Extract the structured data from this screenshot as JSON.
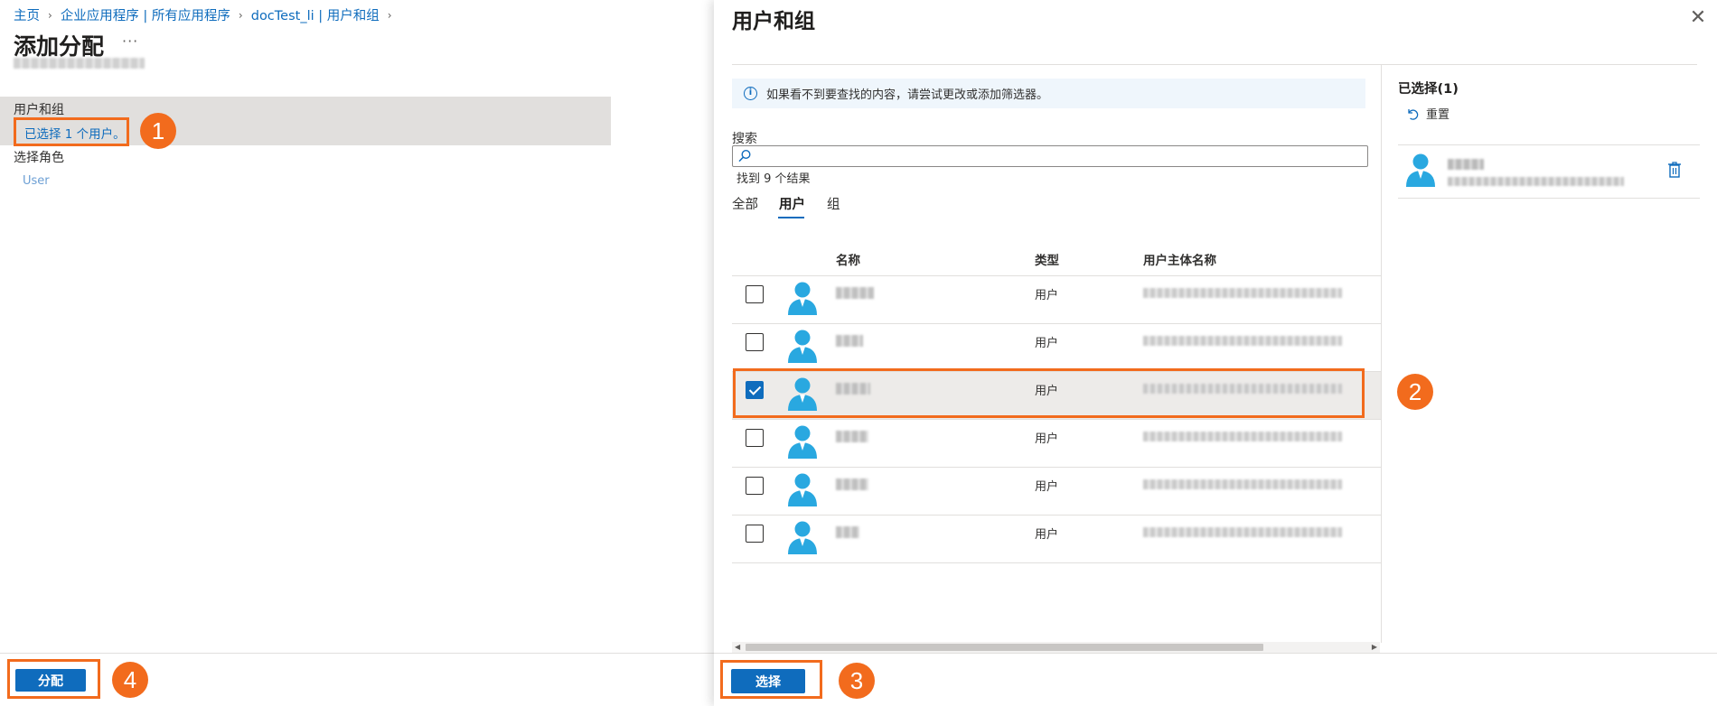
{
  "left": {
    "breadcrumb": [
      "主页",
      "企业应用程序 | 所有应用程序",
      "docTest_li | 用户和组"
    ],
    "breadcrumb_sep": "›",
    "title": "添加分配",
    "more": "···",
    "users_groups_label": "用户和组",
    "selected_users": "已选择 1 个用户。",
    "role_label": "选择角色",
    "role_value": "User",
    "assign_button": "分配"
  },
  "annotations": [
    "1",
    "2",
    "3",
    "4"
  ],
  "blade": {
    "title": "用户和组",
    "close": "✕",
    "info_text": "如果看不到要查找的内容，请尝试更改或添加筛选器。",
    "info_icon": "i",
    "search_label": "搜索",
    "search_placeholder": "",
    "result_count": "找到 9 个结果",
    "tabs": [
      "全部",
      "用户",
      "组"
    ],
    "active_tab": "用户",
    "columns": {
      "name": "名称",
      "type": "类型",
      "upn": "用户主体名称"
    },
    "rows": [
      {
        "type": "用户",
        "checked": false
      },
      {
        "type": "用户",
        "checked": false
      },
      {
        "type": "用户",
        "checked": true
      },
      {
        "type": "用户",
        "checked": false
      },
      {
        "type": "用户",
        "checked": false
      },
      {
        "type": "用户",
        "checked": false
      }
    ],
    "scroll_left": "◀",
    "scroll_right": "▶",
    "selected_heading": "已选择(1)",
    "reset_label": "重置",
    "select_button": "选择"
  },
  "colors": {
    "accent": "#0f6cbd",
    "annotation": "#f26b1d",
    "selected_row": "#edebe9",
    "avatar": "#29a8e0"
  },
  "icons": [
    "info-icon",
    "search-icon",
    "close-icon",
    "reset-icon",
    "trash-icon",
    "user-avatar-icon"
  ]
}
